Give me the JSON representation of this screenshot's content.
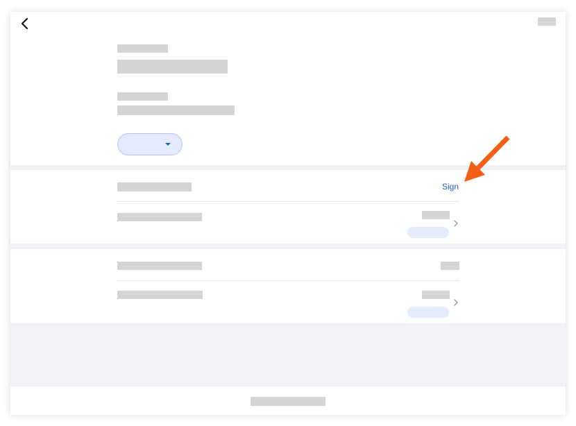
{
  "nav": {
    "back_icon": "chevron-left-icon"
  },
  "signature_section": {
    "action_label": "Sign"
  },
  "row_chevron_icon": "chevron-right-icon",
  "colors": {
    "link": "#1a5fd0",
    "annotation_arrow": "#f45f17",
    "placeholder": "#d4d4d7",
    "pill": "#e3ebfc",
    "background": "#f1f1f6"
  }
}
